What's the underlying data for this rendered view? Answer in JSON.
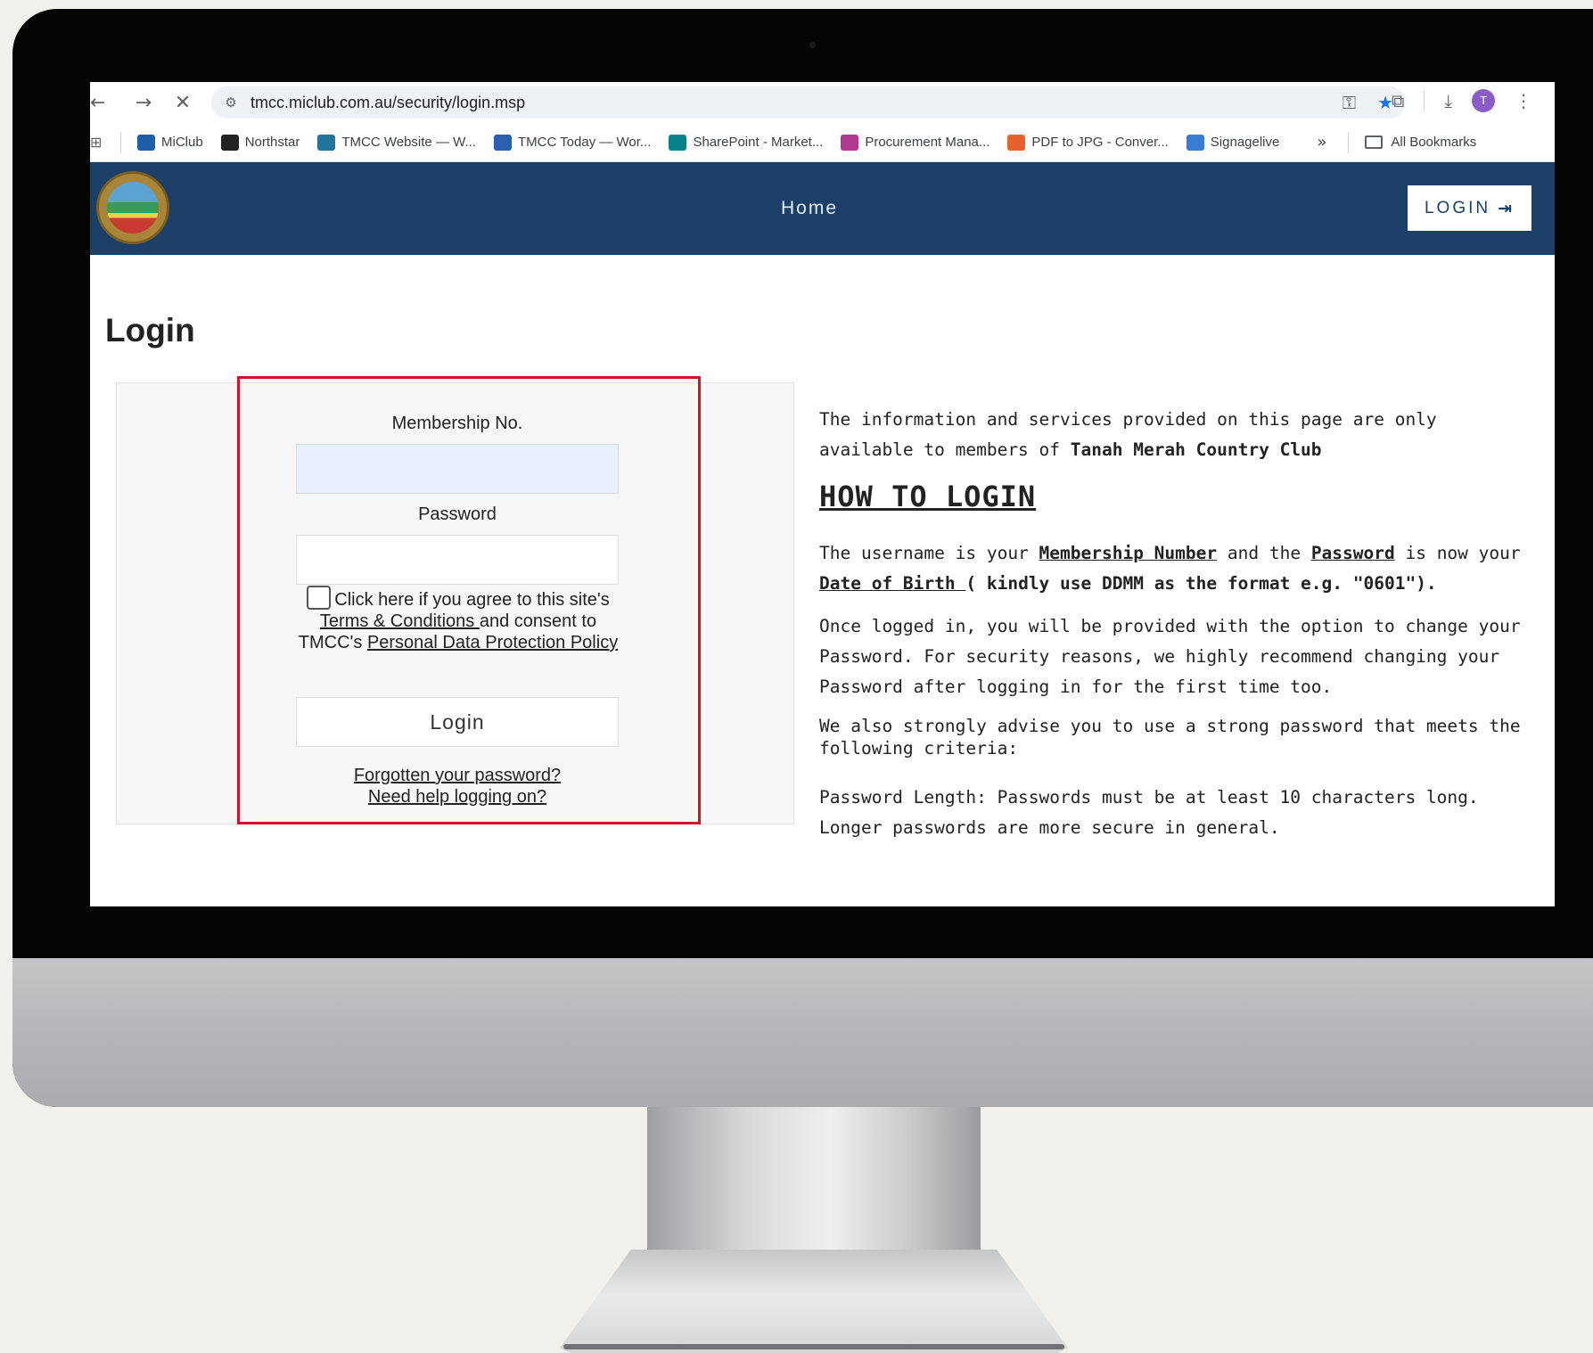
{
  "browser": {
    "url": "tmcc.miclub.com.au/security/login.msp",
    "avatar_letter": "T",
    "bookmarks": [
      {
        "label": "MiClub",
        "icon": "miclub-icon",
        "color": "#1f5fa8"
      },
      {
        "label": "Northstar",
        "icon": "northstar-icon",
        "color": "#222222"
      },
      {
        "label": "TMCC Website — W...",
        "icon": "wordpress-icon",
        "color": "#21759b"
      },
      {
        "label": "TMCC Today — Wor...",
        "icon": "tmcc-today-icon",
        "color": "#2b5fb0"
      },
      {
        "label": "SharePoint - Market...",
        "icon": "sharepoint-icon",
        "color": "#038387"
      },
      {
        "label": "Procurement Mana...",
        "icon": "procurement-icon",
        "color": "#b03a8f"
      },
      {
        "label": "PDF to JPG - Conver...",
        "icon": "pdf-to-jpg-icon",
        "color": "#e8612c"
      },
      {
        "label": "Signagelive",
        "icon": "signagelive-icon",
        "color": "#3a7bd5"
      }
    ],
    "more_bookmarks": "»",
    "all_bookmarks": "All Bookmarks"
  },
  "header": {
    "nav_home": "Home",
    "login_button": "LOGIN",
    "brand_color": "#1c3f67"
  },
  "page": {
    "title": "Login",
    "form": {
      "membership_label": "Membership No.",
      "membership_value": "",
      "password_label": "Password",
      "password_value": "",
      "agree_text_1": "Click here if you agree to this site's ",
      "terms_link": "Terms & Conditions ",
      "agree_text_2": "and consent to TMCC's ",
      "privacy_link": "Personal Data Protection Policy",
      "submit_label": "Login",
      "forgot_link": "Forgotten your password?",
      "help_link": "Need help logging on?"
    },
    "info": {
      "intro_1": "The information and services provided on this page are only available to members of ",
      "club_name": "Tanah Merah Country Club",
      "heading": "HOW TO LOGIN",
      "username_1": "The username is your ",
      "membership_number": "Membership Number",
      "username_2": " and the ",
      "password_word": "Password",
      "username_3": " is now your ",
      "date_of_birth": "Date of Birth ",
      "format_note": "( kindly use DDMM as the format e.g. \"0601\").",
      "once_logged": "Once logged in, you will be provided with the option to change your Password. For security reasons, we highly recommend changing your Password after logging in for the first time too.",
      "advise": "We also strongly advise you to use a strong password that meets the following criteria:",
      "length": "Password Length: Passwords must be at least 10 characters long. Longer passwords are more secure in general."
    }
  },
  "highlight_color": "#d0132c"
}
